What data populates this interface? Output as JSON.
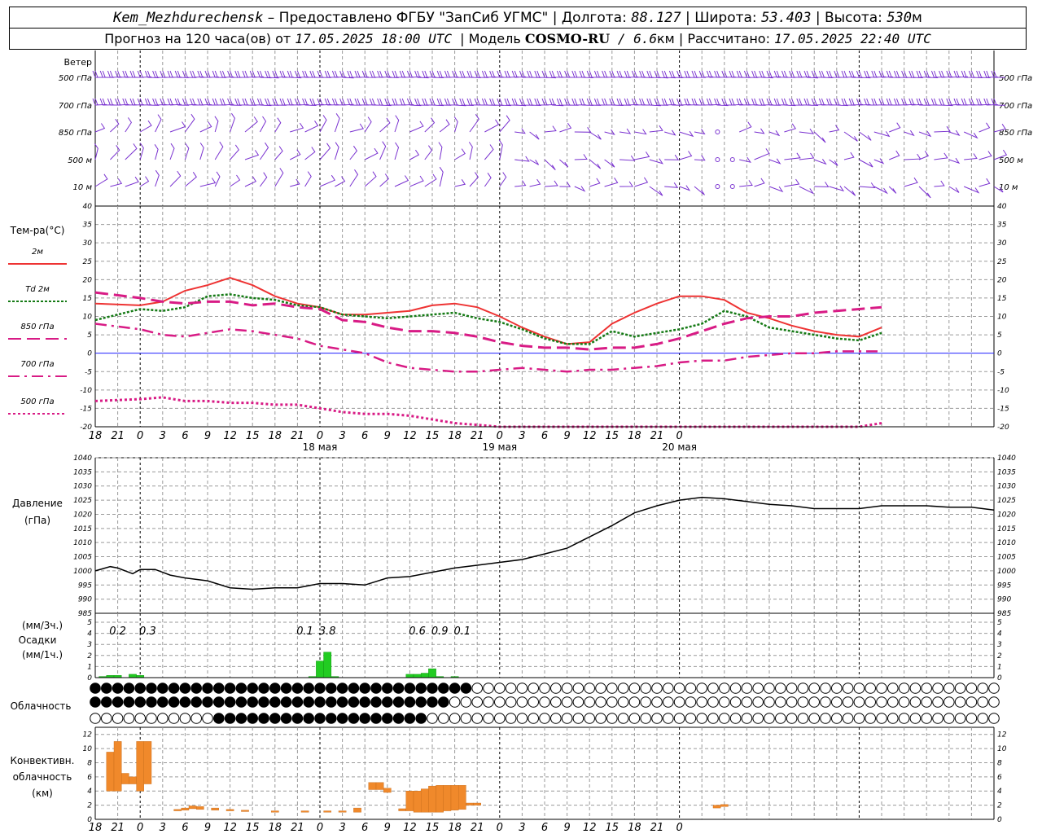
{
  "header": {
    "line1": {
      "station": "Kem_Mezhdurechensk",
      "provider": " – Предоставлено ФГБУ \"ЗапСиб УГМС\" | Долгота: ",
      "lon": "88.127",
      "lat_label": " | Широта: ",
      "lat": "53.403",
      "alt_label": " | Высота: ",
      "alt": "530",
      "alt_unit": "м"
    },
    "line2": {
      "forecast_label": "Прогноз на 120 часа(ов) от ",
      "issued": "17.05.2025 18:00 UTC",
      "model_label": "  | Модель ",
      "model": "COSMO-RU",
      "resolution": " / 6.6",
      "res_unit": "км",
      "calc_label": " | Рассчитано: ",
      "calculated": "17.05.2025 22:40 UTC"
    }
  },
  "chart_data": [
    {
      "panel": "wind",
      "type": "wind-barbs",
      "title": "Ветер",
      "levels": [
        "500 гПа",
        "700 гПа",
        "850 гПа",
        "500 м",
        "10 м"
      ],
      "x": {
        "start_hour": 18,
        "step_hours": 1,
        "count": 121
      }
    },
    {
      "panel": "temperature",
      "type": "line",
      "title": "Тем-ра(°C)",
      "ylim": [
        -20,
        40
      ],
      "yticks": [
        -20,
        -15,
        -10,
        -5,
        0,
        5,
        10,
        15,
        20,
        25,
        30,
        35,
        40
      ],
      "x_hours": [
        0,
        6,
        9,
        12,
        15,
        18,
        21,
        24,
        27,
        30,
        33,
        36,
        39,
        42,
        45,
        48,
        51,
        54,
        57,
        60,
        63,
        66,
        69,
        72,
        75,
        78,
        81,
        84,
        87,
        90,
        93,
        96,
        99,
        102,
        105,
        108,
        111,
        114,
        117,
        120
      ],
      "series": [
        {
          "name": "2м",
          "color": "#ee3333",
          "dash": "solid",
          "values": [
            13.5,
            13,
            14,
            17,
            18.5,
            20.5,
            18.5,
            15.5,
            13.5,
            12.5,
            10.5,
            10.5,
            11,
            11.5,
            13,
            13.5,
            12.5,
            10,
            7,
            4.5,
            2.5,
            3,
            8,
            11,
            13.5,
            15.5,
            15.5,
            14.5,
            11,
            9.5,
            7.5,
            6,
            5,
            4.5,
            7
          ]
        },
        {
          "name": "Td 2м",
          "color": "#157a15",
          "dash": "dot",
          "values": [
            9,
            12,
            11.5,
            12.5,
            15.5,
            16,
            15,
            14.5,
            13,
            12.5,
            10.5,
            10,
            9.5,
            10,
            10.5,
            11,
            9.5,
            8.5,
            6.5,
            4,
            2.5,
            2.5,
            6,
            4.5,
            5.5,
            6.5,
            8,
            11.5,
            10,
            7,
            6,
            5,
            4,
            3.5,
            5.5
          ]
        },
        {
          "name": "850 гПа",
          "color": "#d81b85",
          "dash": "long",
          "values": [
            16.5,
            15,
            14,
            13.5,
            14,
            14,
            13,
            13.5,
            12.5,
            12,
            9,
            8.5,
            7,
            6,
            6,
            5.5,
            4.5,
            3,
            2,
            1.5,
            1.5,
            1,
            1.5,
            1.5,
            2.5,
            4,
            6,
            8,
            9.5,
            10,
            10,
            11,
            11.5,
            12,
            12.5
          ]
        },
        {
          "name": "700 гПа",
          "color": "#d81b85",
          "dash": "dashdot",
          "values": [
            8,
            6.5,
            5,
            4.5,
            5.5,
            6.5,
            6,
            5,
            4,
            2,
            1,
            0,
            -2.5,
            -4,
            -4.5,
            -5,
            -5,
            -4.5,
            -4,
            -4.5,
            -5,
            -4.5,
            -4.5,
            -4,
            -3.5,
            -2.5,
            -2,
            -2,
            -1,
            -0.5,
            0,
            0,
            0.5,
            0.5,
            0.5
          ]
        },
        {
          "name": "500 гПа",
          "color": "#d81b85",
          "dash": "dense-dot",
          "values": [
            -13,
            -12.5,
            -12,
            -13,
            -13,
            -13.5,
            -13.5,
            -14,
            -14,
            -15,
            -16,
            -16.5,
            -16.5,
            -17,
            -18,
            -19,
            -19.5,
            -21,
            -21,
            -21,
            -21,
            -21,
            -21,
            -21,
            -21,
            -21,
            -21,
            -21,
            -21,
            -21,
            -21,
            -21,
            -21,
            -20,
            -19
          ]
        }
      ],
      "date_labels": [
        "18 мая",
        "19 мая",
        "20 мая"
      ]
    },
    {
      "panel": "pressure",
      "type": "line",
      "title": "Давление",
      "ylabel": "(гПа)",
      "ylim": [
        985,
        1040
      ],
      "yticks": [
        985,
        990,
        995,
        1000,
        1005,
        1010,
        1015,
        1020,
        1025,
        1030,
        1035,
        1040
      ],
      "x_hours": [
        0,
        2,
        3,
        5,
        6,
        8,
        10,
        12,
        15,
        18,
        21,
        24,
        27,
        30,
        33,
        36,
        39,
        42,
        45,
        48,
        51,
        54,
        57,
        60,
        63,
        66,
        69,
        72,
        75,
        78,
        81,
        84,
        87,
        90,
        93,
        96,
        99,
        102,
        105,
        108,
        111,
        114,
        117,
        120
      ],
      "series": [
        {
          "name": "",
          "values": [
            1000,
            1001.5,
            1001,
            999,
            1000.5,
            1000.5,
            998.5,
            997.5,
            996.5,
            994,
            993.5,
            994,
            994,
            995.5,
            995.5,
            995,
            997.5,
            998,
            999.5,
            1001,
            1002,
            1003,
            1004,
            1006,
            1008,
            1012,
            1016,
            1020.5,
            1023,
            1025,
            1026,
            1025.5,
            1024.5,
            1023.5,
            1023,
            1022,
            1022,
            1022,
            1023,
            1023,
            1023,
            1022.5,
            1022.5,
            1021.5
          ]
        }
      ]
    },
    {
      "panel": "precipitation",
      "type": "bar",
      "title": "Осадки",
      "ylabel_top": "(мм/3ч.)",
      "ylabel_bottom": "(мм/1ч.)",
      "ylim": [
        0,
        5
      ],
      "yticks": [
        0,
        1,
        2,
        3,
        4,
        5
      ],
      "totals_3h": [
        {
          "x_hour": 3,
          "label": "0.2"
        },
        {
          "x_hour": 7,
          "label": "0.3"
        },
        {
          "x_hour": 28,
          "label": "0.1"
        },
        {
          "x_hour": 31,
          "label": "3.8"
        },
        {
          "x_hour": 43,
          "label": "0.6"
        },
        {
          "x_hour": 46,
          "label": "0.9"
        },
        {
          "x_hour": 49,
          "label": "0.1"
        }
      ],
      "bars_1h": [
        {
          "x_hour": 1,
          "value": 0.1
        },
        {
          "x_hour": 2,
          "value": 0.2
        },
        {
          "x_hour": 3,
          "value": 0.2
        },
        {
          "x_hour": 5,
          "value": 0.3
        },
        {
          "x_hour": 6,
          "value": 0.2
        },
        {
          "x_hour": 29,
          "value": 0.1
        },
        {
          "x_hour": 30,
          "value": 1.5
        },
        {
          "x_hour": 31,
          "value": 2.3
        },
        {
          "x_hour": 32,
          "value": 0.1
        },
        {
          "x_hour": 42,
          "value": 0.3
        },
        {
          "x_hour": 43,
          "value": 0.3
        },
        {
          "x_hour": 44,
          "value": 0.4
        },
        {
          "x_hour": 45,
          "value": 0.8
        },
        {
          "x_hour": 46,
          "value": 0.1
        },
        {
          "x_hour": 48,
          "value": 0.1
        }
      ]
    },
    {
      "panel": "clouds",
      "type": "symbol-rows",
      "title": "Облачность",
      "rows": [
        {
          "name": "upper",
          "filled_to_hour": 50
        },
        {
          "name": "middle",
          "filled_to_hour": 47
        },
        {
          "name": "lower",
          "filled_from_hour": 16,
          "filled_to_hour": 44
        }
      ]
    },
    {
      "panel": "convective",
      "type": "range-bar",
      "title": "Конвективн.",
      "title2": "облачность",
      "ylabel": "(км)",
      "ylim": [
        0,
        13
      ],
      "yticks": [
        0,
        2,
        4,
        6,
        8,
        10,
        12
      ],
      "color": "#f0892b",
      "bars": [
        {
          "x_hour": 2,
          "base": 4,
          "top": 9.5
        },
        {
          "x_hour": 3,
          "base": 4,
          "top": 11
        },
        {
          "x_hour": 4,
          "base": 5,
          "top": 6.5
        },
        {
          "x_hour": 5,
          "base": 5,
          "top": 6
        },
        {
          "x_hour": 6,
          "base": 4,
          "top": 11
        },
        {
          "x_hour": 7,
          "base": 5,
          "top": 11
        },
        {
          "x_hour": 11,
          "base": 1.2,
          "top": 1.4
        },
        {
          "x_hour": 12,
          "base": 1.3,
          "top": 1.6
        },
        {
          "x_hour": 13,
          "base": 1.5,
          "top": 1.9
        },
        {
          "x_hour": 14,
          "base": 1.4,
          "top": 1.8
        },
        {
          "x_hour": 16,
          "base": 1.3,
          "top": 1.6
        },
        {
          "x_hour": 18,
          "base": 1.2,
          "top": 1.4
        },
        {
          "x_hour": 20,
          "base": 1.1,
          "top": 1.3
        },
        {
          "x_hour": 24,
          "base": 1.0,
          "top": 1.2
        },
        {
          "x_hour": 28,
          "base": 1.0,
          "top": 1.2
        },
        {
          "x_hour": 31,
          "base": 1.0,
          "top": 1.2
        },
        {
          "x_hour": 33,
          "base": 1.0,
          "top": 1.2
        },
        {
          "x_hour": 35,
          "base": 1.0,
          "top": 1.6
        },
        {
          "x_hour": 37,
          "base": 4.2,
          "top": 5.2
        },
        {
          "x_hour": 38,
          "base": 4.2,
          "top": 5.2
        },
        {
          "x_hour": 39,
          "base": 3.8,
          "top": 4.4
        },
        {
          "x_hour": 41,
          "base": 1.2,
          "top": 1.5
        },
        {
          "x_hour": 42,
          "base": 1.2,
          "top": 4
        },
        {
          "x_hour": 43,
          "base": 1,
          "top": 4
        },
        {
          "x_hour": 44,
          "base": 1,
          "top": 4.3
        },
        {
          "x_hour": 45,
          "base": 1,
          "top": 4.7
        },
        {
          "x_hour": 46,
          "base": 1,
          "top": 4.8
        },
        {
          "x_hour": 47,
          "base": 1.2,
          "top": 4.8
        },
        {
          "x_hour": 48,
          "base": 1.3,
          "top": 4.8
        },
        {
          "x_hour": 49,
          "base": 1.4,
          "top": 4.8
        },
        {
          "x_hour": 50,
          "base": 2.0,
          "top": 2.3
        },
        {
          "x_hour": 51,
          "base": 2.0,
          "top": 2.3
        },
        {
          "x_hour": 83,
          "base": 1.6,
          "top": 2.0
        },
        {
          "x_hour": 84,
          "base": 1.8,
          "top": 2.1
        }
      ]
    }
  ],
  "x_axis": {
    "tick_labels": [
      "18",
      "21",
      "0",
      "3",
      "6",
      "9",
      "12",
      "15",
      "18",
      "21",
      "0",
      "3",
      "6",
      "9",
      "12",
      "15",
      "18",
      "21",
      "0",
      "3",
      "6",
      "9",
      "12",
      "15",
      "18",
      "21",
      "0"
    ]
  },
  "colors": {
    "wind": "#7a32d0",
    "grid": "#9a9a9a",
    "zero_line": "#2020ff",
    "precip": "#22cc22",
    "pressure": "#000000"
  }
}
